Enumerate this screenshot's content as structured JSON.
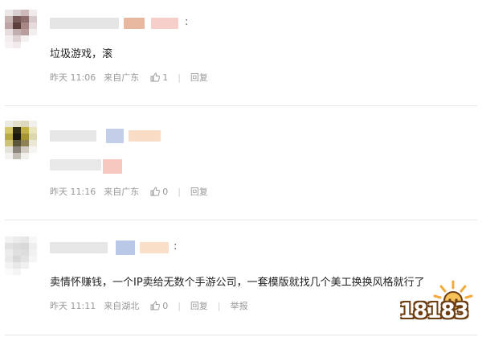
{
  "comments": [
    {
      "text": "垃圾游戏，滚",
      "time": "昨天 11:06",
      "location": "来自广东",
      "likes": "1",
      "reply_label": "回复",
      "colon": ":"
    },
    {
      "text": "",
      "time": "昨天 11:16",
      "location": "来自广东",
      "likes": "0",
      "reply_label": "回复",
      "colon": ":"
    },
    {
      "text": "卖情怀赚钱，一个IP卖给无数个手游公司，一套模版就找几个美工换换风格就行了",
      "time": "昨天 11:11",
      "location": "来自湖北",
      "likes": "0",
      "reply_label": "回复",
      "report_label": "举报",
      "colon": ":"
    }
  ],
  "logo": {
    "text": "18183"
  },
  "icons": {
    "like": "thumbs-up-icon"
  },
  "colors": {
    "meta": "#999999",
    "divider": "#e6e6e6",
    "logo_outline": "#6b3d11",
    "logo_sun": "#f3a93c"
  }
}
